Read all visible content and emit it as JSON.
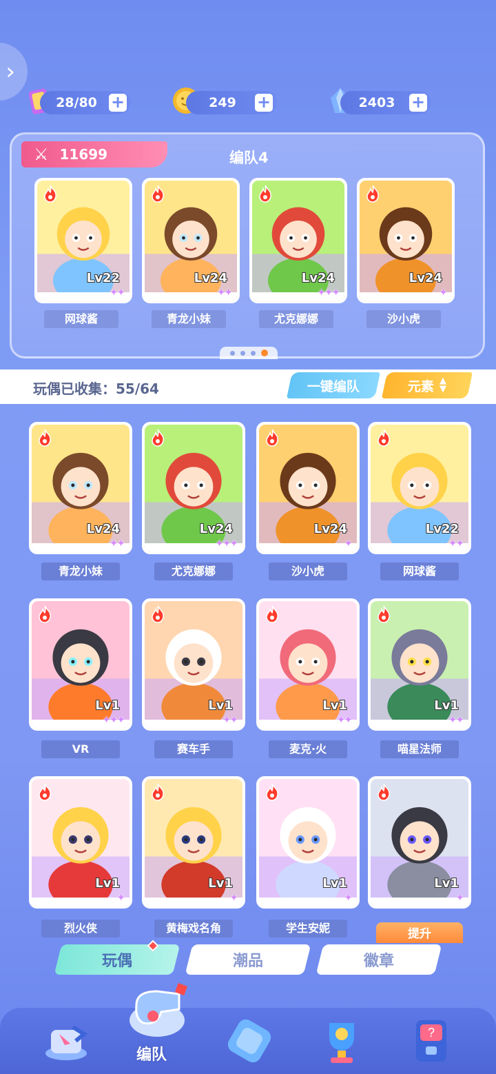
{
  "resources": [
    {
      "icon": "energy-card-icon",
      "value": "28/80"
    },
    {
      "icon": "coin-icon",
      "value": "249"
    },
    {
      "icon": "crystal-icon",
      "value": "2403"
    }
  ],
  "team": {
    "power": "11699",
    "title": "编队4",
    "members": [
      {
        "name": "网球酱",
        "level": "Lv22",
        "stars": "✦✦"
      },
      {
        "name": "青龙小妹",
        "level": "Lv24",
        "stars": "✦✦"
      },
      {
        "name": "尤克娜娜",
        "level": "Lv24",
        "stars": "✦✦✦"
      },
      {
        "name": "沙小虎",
        "level": "Lv24",
        "stars": "✦"
      }
    ]
  },
  "collection": {
    "text": "玩偶已收集：55/64",
    "one_click_label": "一键编队",
    "element_label": "元素"
  },
  "dolls": [
    {
      "name": "青龙小妹",
      "level": "Lv24",
      "stars": "✦✦"
    },
    {
      "name": "尤克娜娜",
      "level": "Lv24",
      "stars": "✦✦✦"
    },
    {
      "name": "沙小虎",
      "level": "Lv24",
      "stars": "✦"
    },
    {
      "name": "网球酱",
      "level": "Lv22",
      "stars": "✦✦"
    },
    {
      "name": "VR",
      "level": "Lv1",
      "stars": "✦✦✦"
    },
    {
      "name": "赛车手",
      "level": "Lv1",
      "stars": "✦✦"
    },
    {
      "name": "麦克·火",
      "level": "Lv1",
      "stars": "✦✦"
    },
    {
      "name": "喵星法师",
      "level": "Lv1",
      "stars": "✦✦"
    },
    {
      "name": "烈火侠",
      "level": "Lv1",
      "stars": "✦"
    },
    {
      "name": "黄梅戏名角",
      "level": "Lv1",
      "stars": "✦"
    },
    {
      "name": "学生安妮",
      "level": "Lv1",
      "stars": "✦"
    },
    {
      "name": "",
      "level": "Lv1",
      "stars": "✦"
    }
  ],
  "promote_label": "提升",
  "tabs": [
    {
      "label": "玩偶",
      "active": true
    },
    {
      "label": "潮品",
      "active": false
    },
    {
      "label": "徽章",
      "active": false
    }
  ],
  "nav": {
    "active_label": "编队",
    "items": [
      "team-icon",
      "whistle-icon",
      "dice-icon",
      "trophy-icon",
      "gacha-machine-icon"
    ]
  },
  "colors": {
    "background": "#7f9cf5",
    "power_tag": "#f05a8c",
    "element_button": "#ffb52e",
    "one_click_button": "#62c4f5",
    "active_tab": "#7ee7d9",
    "star": "#d68cff"
  }
}
